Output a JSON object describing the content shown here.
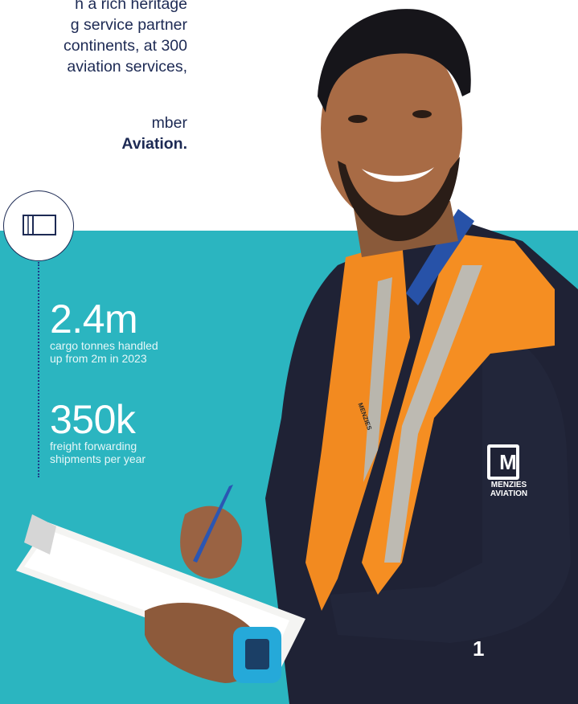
{
  "intro": {
    "line1": "h a rich heritage",
    "line2": "g service partner",
    "line3": "continents, at 300",
    "line4": "aviation services,",
    "line5": "mber",
    "line6": "Aviation."
  },
  "stats": [
    {
      "value": "2.4m",
      "desc1": "cargo tonnes handled",
      "desc2": "up from 2m in 2023"
    },
    {
      "value": "350k",
      "desc1": "freight forwarding",
      "desc2": "shipments per year"
    }
  ],
  "sleeve_logo": {
    "letter": "M",
    "line1": "MENZIES",
    "line2": "AVIATION"
  },
  "vest_logo": "MENZIES",
  "page_number": "1",
  "colors": {
    "teal": "#2bb5c0",
    "navy": "#1d2a54",
    "vest": "#f28a20"
  }
}
